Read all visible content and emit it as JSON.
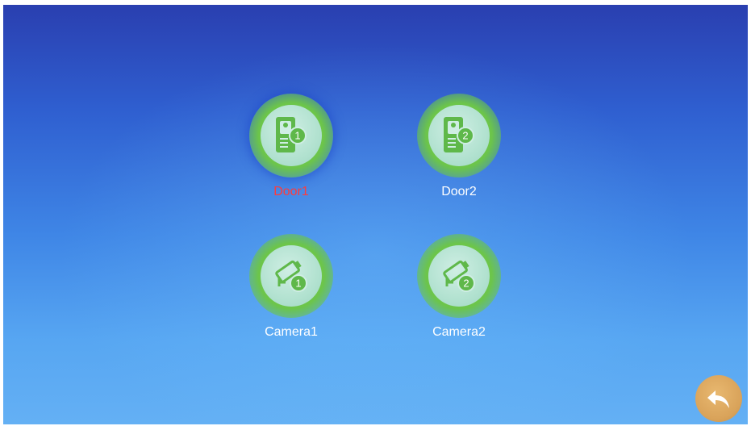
{
  "theme": {
    "selected_label_color": "#ff3b3b",
    "label_color": "#ffffff",
    "icon_ring_color": "#6cc54a",
    "back_button_color": "#d9a35a"
  },
  "tiles": [
    {
      "label": "Door1",
      "badge": "1",
      "icon": "door-station-icon",
      "selected": true
    },
    {
      "label": "Door2",
      "badge": "2",
      "icon": "door-station-icon",
      "selected": false
    },
    {
      "label": "Camera1",
      "badge": "1",
      "icon": "camera-icon",
      "selected": false
    },
    {
      "label": "Camera2",
      "badge": "2",
      "icon": "camera-icon",
      "selected": false
    }
  ],
  "back_button": {
    "icon": "back-arrow-icon"
  }
}
